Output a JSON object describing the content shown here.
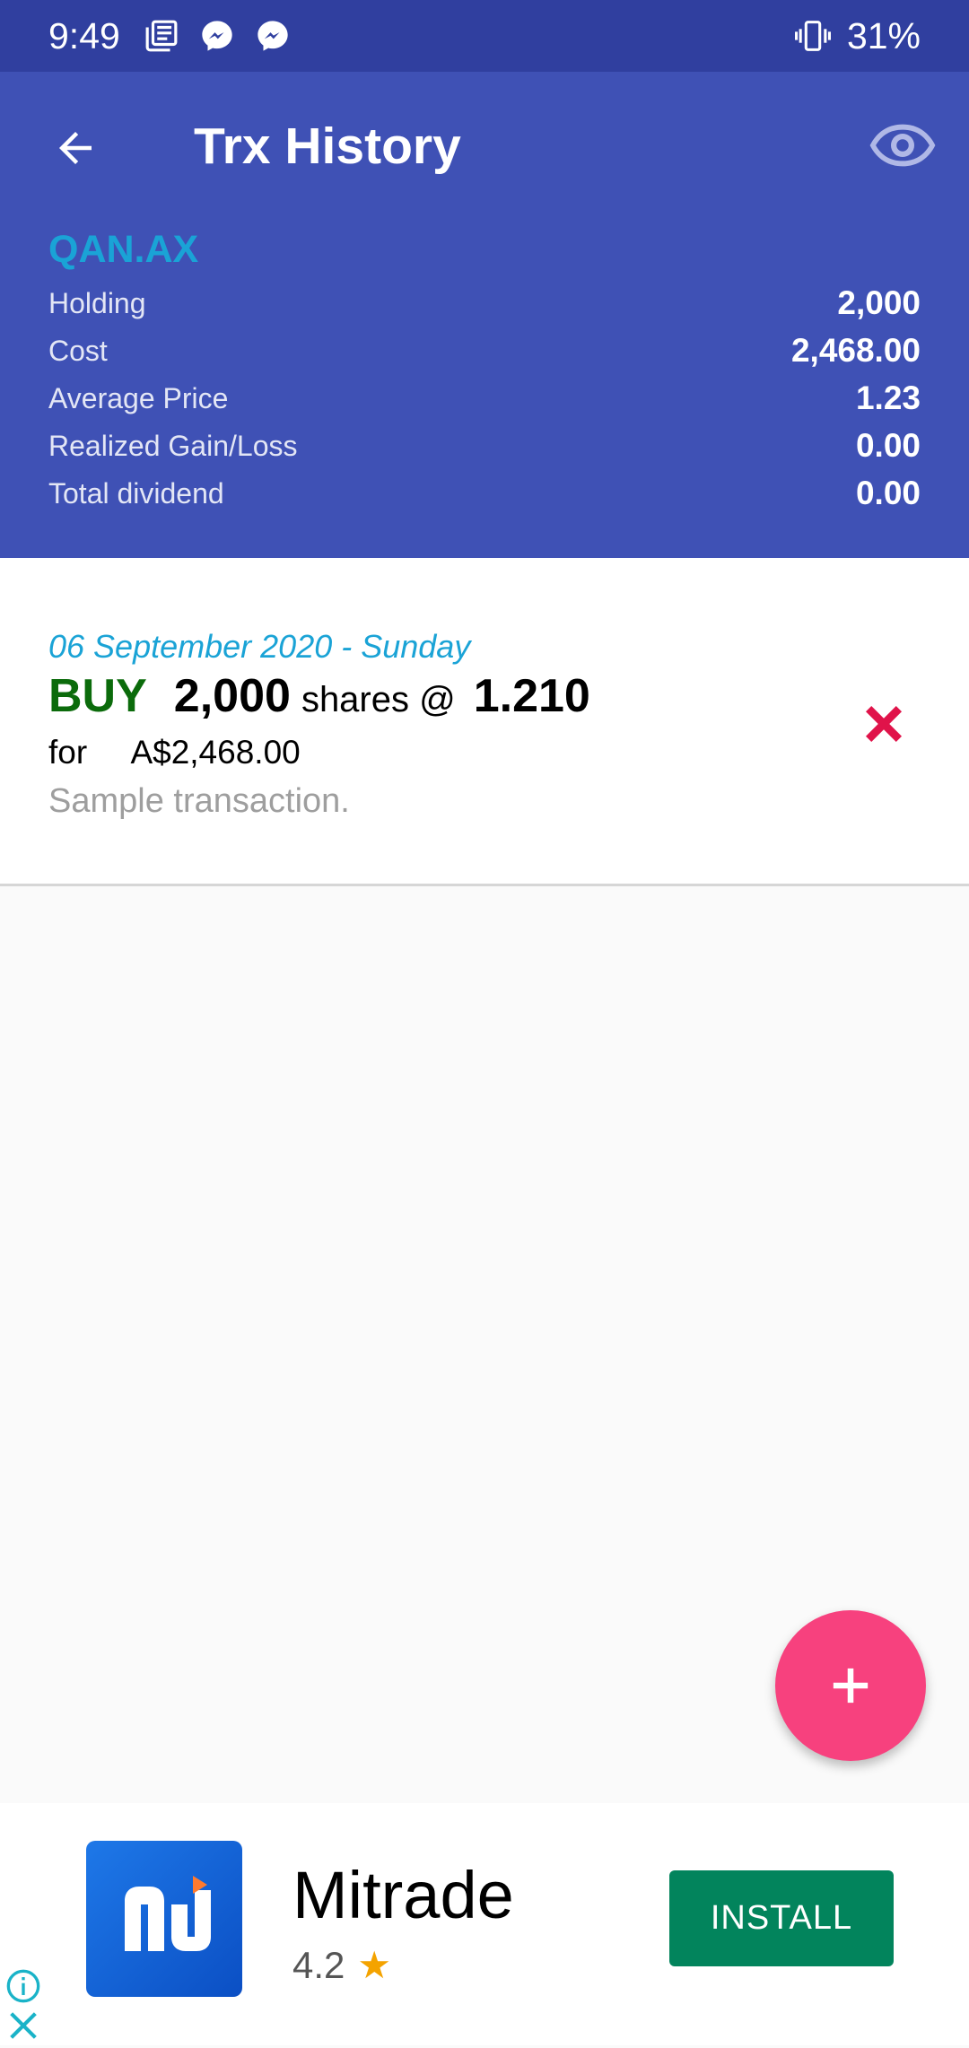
{
  "status_bar": {
    "time": "9:49",
    "battery": "31%",
    "icons": [
      "news-icon",
      "messenger-icon",
      "messenger-icon",
      "vibrate-icon"
    ]
  },
  "appbar": {
    "title": "Trx History",
    "back_icon": "arrow-back-icon",
    "eye_icon": "eye-icon",
    "background": "#3f51b5"
  },
  "summary": {
    "ticker": "QAN.AX",
    "rows": [
      {
        "label": "Holding",
        "value": "2,000"
      },
      {
        "label": "Cost",
        "value": "2,468.00"
      },
      {
        "label": "Average Price",
        "value": "1.23"
      },
      {
        "label": "Realized Gain/Loss",
        "value": "0.00"
      },
      {
        "label": "Total dividend",
        "value": "0.00"
      }
    ]
  },
  "transactions": [
    {
      "date": "06 September 2020 - Sunday",
      "type": "BUY",
      "quantity": "2,000",
      "shares_label": "shares @",
      "price": "1.210",
      "for_label": "for",
      "amount": "A$2,468.00",
      "note": "Sample transaction."
    }
  ],
  "fab": {
    "icon": "plus-icon",
    "color": "#f7417e"
  },
  "ad": {
    "name": "Mitrade",
    "rating": "4.2",
    "install_label": "INSTALL",
    "install_color": "#02845c"
  }
}
